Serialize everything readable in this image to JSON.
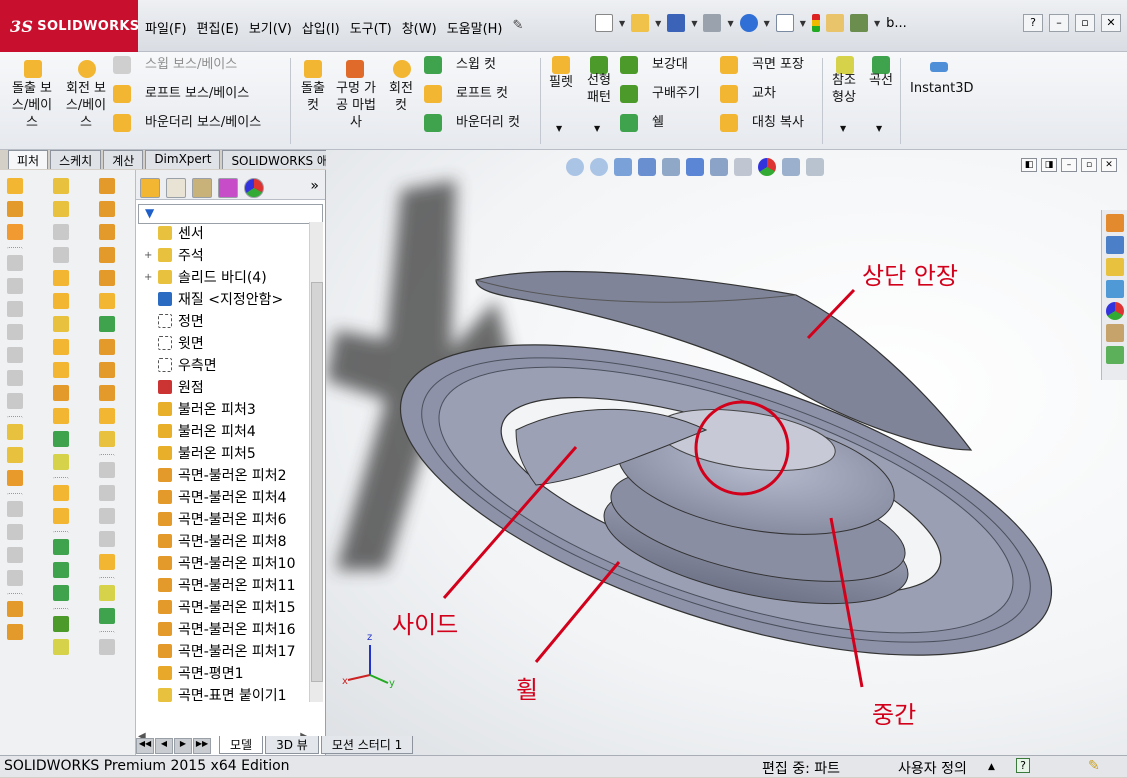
{
  "app": {
    "logo_text": "SOLIDWORKS",
    "logo_mark": "3S"
  },
  "menu": [
    "파일(F)",
    "편집(E)",
    "보기(V)",
    "삽입(I)",
    "도구(T)",
    "창(W)",
    "도움말(H)"
  ],
  "search_user": "b...",
  "ribbon": {
    "extrude_boss": "돌출 보스/베이스",
    "revolve_boss": "회전 보스/베이스",
    "swept_boss": "스윕 보스/베이스",
    "loft_boss": "로프트 보스/베이스",
    "boundary_boss": "바운더리 보스/베이스",
    "extrude_cut": "돌출 컷",
    "hole_wizard": "구멍 가공 마법사",
    "revolve_cut": "회전 컷",
    "swept_cut": "스윕 컷",
    "loft_cut": "로프트 컷",
    "boundary_cut": "바운더리 컷",
    "fillet": "필렛",
    "linear_pattern": "선형 패턴",
    "rib": "보강대",
    "draft": "구배주기",
    "shell": "쉘",
    "wrap": "곡면 포장",
    "intersect": "교차",
    "mirror": "대칭 복사",
    "ref_geometry": "참조 형상",
    "curves": "곡선",
    "instant3d": "Instant3D"
  },
  "tabs": [
    "피처",
    "스케치",
    "계산",
    "DimXpert",
    "SOLIDWORKS 애드인"
  ],
  "tree": {
    "items": [
      {
        "label": "센서",
        "icon": "sensor-folder-icon",
        "expand": ""
      },
      {
        "label": "주석",
        "icon": "annotation-icon",
        "expand": "+"
      },
      {
        "label": "솔리드 바디(4)",
        "icon": "solid-bodies-folder-icon",
        "expand": "+"
      },
      {
        "label": "재질 <지정안함>",
        "icon": "material-icon",
        "expand": ""
      },
      {
        "label": "정면",
        "icon": "plane-icon",
        "expand": ""
      },
      {
        "label": "윗면",
        "icon": "plane-icon",
        "expand": ""
      },
      {
        "label": "우측면",
        "icon": "plane-icon",
        "expand": ""
      },
      {
        "label": "원점",
        "icon": "origin-icon",
        "expand": ""
      },
      {
        "label": "불러온 피처3",
        "icon": "imported-feature-icon",
        "expand": ""
      },
      {
        "label": "불러온 피처4",
        "icon": "imported-feature-icon",
        "expand": ""
      },
      {
        "label": "불러온 피처5",
        "icon": "imported-feature-icon",
        "expand": ""
      },
      {
        "label": "곡면-불러온 피처2",
        "icon": "surface-imported-icon",
        "expand": ""
      },
      {
        "label": "곡면-불러온 피처4",
        "icon": "surface-imported-icon",
        "expand": ""
      },
      {
        "label": "곡면-불러온 피처6",
        "icon": "surface-imported-icon",
        "expand": ""
      },
      {
        "label": "곡면-불러온 피처8",
        "icon": "surface-imported-icon",
        "expand": ""
      },
      {
        "label": "곡면-불러온 피처10",
        "icon": "surface-imported-icon",
        "expand": ""
      },
      {
        "label": "곡면-불러온 피처11",
        "icon": "surface-imported-icon",
        "expand": ""
      },
      {
        "label": "곡면-불러온 피처15",
        "icon": "surface-imported-icon",
        "expand": ""
      },
      {
        "label": "곡면-불러온 피처16",
        "icon": "surface-imported-icon",
        "expand": ""
      },
      {
        "label": "곡면-불러온 피처17",
        "icon": "surface-imported-icon",
        "expand": ""
      },
      {
        "label": "곡면-평면1",
        "icon": "planar-surface-icon",
        "expand": ""
      },
      {
        "label": "곡면-표면 붙이기1",
        "icon": "knit-surface-icon",
        "expand": ""
      }
    ]
  },
  "annotations": {
    "top_saddle": "상단 안장",
    "side": "사이드",
    "wheel": "휠",
    "middle": "중간"
  },
  "triad": {
    "x": "x",
    "y": "y",
    "z": "z"
  },
  "bottom_tabs": [
    "모델",
    "3D 뷰",
    "모션 스터디 1"
  ],
  "status": {
    "product": "SOLIDWORKS Premium 2015 x64 Edition",
    "editing": "편집 중: 파트",
    "units": "사용자 정의",
    "help": "?"
  },
  "colors": {
    "brand": "#c8102e",
    "annotation": "#d3001b",
    "model": "#8a8fa6"
  }
}
